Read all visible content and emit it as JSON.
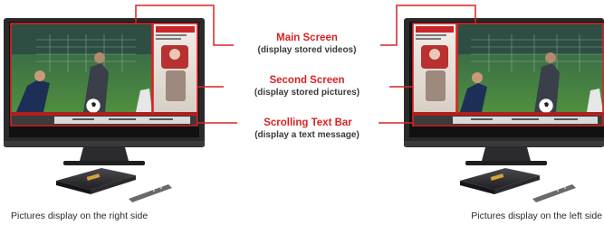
{
  "callouts": [
    {
      "title": "Main Screen",
      "subtitle": "(display stored videos)"
    },
    {
      "title": "Second Screen",
      "subtitle": "(display stored pictures)"
    },
    {
      "title": "Scrolling Text Bar",
      "subtitle": "(display a text message)"
    }
  ],
  "captions": {
    "left": "Pictures display on the right side",
    "right": "Pictures display on the left side"
  },
  "colors": {
    "highlight_red": "#d92323",
    "tv_frame": "#2a2a2c",
    "pitch_green": "#3f7c3a"
  },
  "icons": [
    "television",
    "media-player-box",
    "remote-control",
    "soccer-ball"
  ]
}
